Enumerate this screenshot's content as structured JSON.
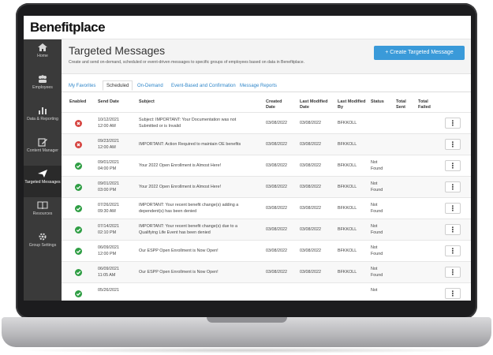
{
  "app": {
    "logo": "Benefitplace"
  },
  "sidebar": {
    "items": [
      {
        "label": "Home",
        "icon": "home-icon"
      },
      {
        "label": "Employees",
        "icon": "employees-icon"
      },
      {
        "label": "Data & Reporting",
        "icon": "bar-chart-icon"
      },
      {
        "label": "Content Manager",
        "icon": "edit-icon"
      },
      {
        "label": "Targeted Messages",
        "icon": "paper-plane-icon",
        "active": true
      },
      {
        "label": "Resources",
        "icon": "book-icon"
      },
      {
        "label": "Group Settings",
        "icon": "gear-icon"
      }
    ]
  },
  "header": {
    "title": "Targeted Messages",
    "subtitle": "Create and send on-demand, scheduled or event-driven messages to specific groups of employees based on data in Benefitplace.",
    "create_button": "+ Create Targeted Message"
  },
  "tabs": [
    {
      "label": "My Favorites"
    },
    {
      "label": "Scheduled",
      "active": true
    },
    {
      "label": "On-Demand"
    },
    {
      "label": "Event-Based and Confirmation"
    },
    {
      "label": "Message Reports"
    }
  ],
  "table": {
    "columns": [
      "Enabled",
      "Send Date",
      "Subject",
      "Created Date",
      "Last Modified Date",
      "Last Modified By",
      "Status",
      "Total Sent",
      "Total Failed"
    ],
    "rows": [
      {
        "enabled": false,
        "date": "10/12/2021",
        "time": "12:00 AM",
        "subject1": "Subject: IMPORTANT: Your Documentation was not",
        "subject2": "Submitted or is Invalid",
        "created": "03/08/2022",
        "modified": "03/08/2022",
        "by": "BFKKOLL",
        "status1": "",
        "status2": ""
      },
      {
        "enabled": false,
        "date": "09/23/2021",
        "time": "12:00 AM",
        "subject1": "IMPORTANT: Action Required to maintain OE benefits",
        "subject2": "",
        "created": "03/08/2022",
        "modified": "03/08/2022",
        "by": "BFKKOLL",
        "status1": "",
        "status2": ""
      },
      {
        "enabled": true,
        "date": "09/01/2021",
        "time": "04:00 PM",
        "subject1": "Your 2022 Open Enrollment is Almost Here!",
        "subject2": "",
        "created": "03/08/2022",
        "modified": "03/08/2022",
        "by": "BFKKOLL",
        "status1": "Not",
        "status2": "Found"
      },
      {
        "enabled": true,
        "date": "09/01/2021",
        "time": "03:00 PM",
        "subject1": "Your 2022 Open Enrollment is Almost Here!",
        "subject2": "",
        "created": "03/08/2022",
        "modified": "03/08/2022",
        "by": "BFKKOLL",
        "status1": "Not",
        "status2": "Found"
      },
      {
        "enabled": true,
        "date": "07/26/2021",
        "time": "09:30 AM",
        "subject1": "IMPORTANT: Your recent benefit change(s) adding a",
        "subject2": "dependent(s) has been denied",
        "created": "03/08/2022",
        "modified": "03/08/2022",
        "by": "BFKKOLL",
        "status1": "Not",
        "status2": "Found"
      },
      {
        "enabled": true,
        "date": "07/14/2021",
        "time": "02:10 PM",
        "subject1": "IMPORTANT: Your recent benefit change(s) due to a",
        "subject2": "Qualifying Life Event has been denied",
        "created": "03/08/2022",
        "modified": "03/08/2022",
        "by": "BFKKOLL",
        "status1": "Not",
        "status2": "Found"
      },
      {
        "enabled": true,
        "date": "06/09/2021",
        "time": "12:00 PM",
        "subject1": "Our ESPP Open Enrollment is Now Open!",
        "subject2": "",
        "created": "03/08/2022",
        "modified": "03/08/2022",
        "by": "BFKKOLL",
        "status1": "Not",
        "status2": "Found"
      },
      {
        "enabled": true,
        "date": "06/09/2021",
        "time": "11:05 AM",
        "subject1": "Our ESPP Open Enrollment is Now Open!",
        "subject2": "",
        "created": "03/08/2022",
        "modified": "03/08/2022",
        "by": "BFKKOLL",
        "status1": "Not",
        "status2": "Found"
      },
      {
        "enabled": true,
        "date": "05/26/2021",
        "time": "",
        "subject1": "",
        "subject2": "",
        "created": "",
        "modified": "",
        "by": "",
        "status1": "Not",
        "status2": ""
      }
    ]
  },
  "colors": {
    "accent": "#3a9ad9",
    "sidebar": "#3a3a3a",
    "success": "#2f9e44",
    "error": "#d64541"
  }
}
